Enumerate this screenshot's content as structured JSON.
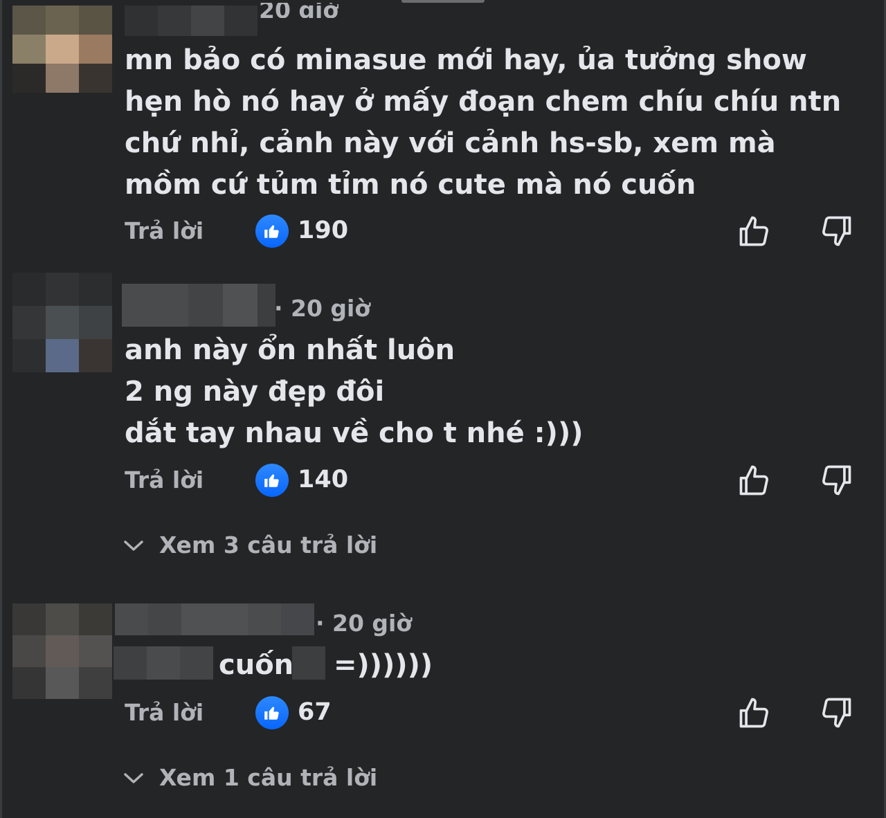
{
  "comments": [
    {
      "time": "20 giờ",
      "text": "mn bảo có minasue mới hay, ủa tưởng show hẹn hò nó hay ở mấy đoạn chem chíu chíu ntn chứ nhỉ, cảnh này với cảnh hs-sb, xem mà mồm cứ tủm tỉm nó cute mà nó cuốn",
      "reply_label": "Trả lời",
      "likes": "190"
    },
    {
      "time": "· 20 giờ",
      "text": "anh này ổn nhất luôn\n2 ng này đẹp đôi\ndắt tay nhau về cho t nhé :)))",
      "reply_label": "Trả lời",
      "likes": "140",
      "view_replies": "Xem 3 câu trả lời"
    },
    {
      "time": "· 20 giờ",
      "text_part1": "cuốn",
      "text_part2": "=))))))",
      "reply_label": "Trả lời",
      "likes": "67",
      "view_replies": "Xem 1 câu trả lời"
    }
  ],
  "icons": {
    "like_badge": "thumbs-up-icon",
    "like_button": "thumbs-up-outline-icon",
    "dislike_button": "thumbs-down-outline-icon",
    "expand": "chevron-down-icon"
  },
  "colors": {
    "background": "#242526",
    "accent": "#0866ff",
    "text_primary": "#e4e6eb",
    "text_secondary": "#b0b3b8"
  }
}
